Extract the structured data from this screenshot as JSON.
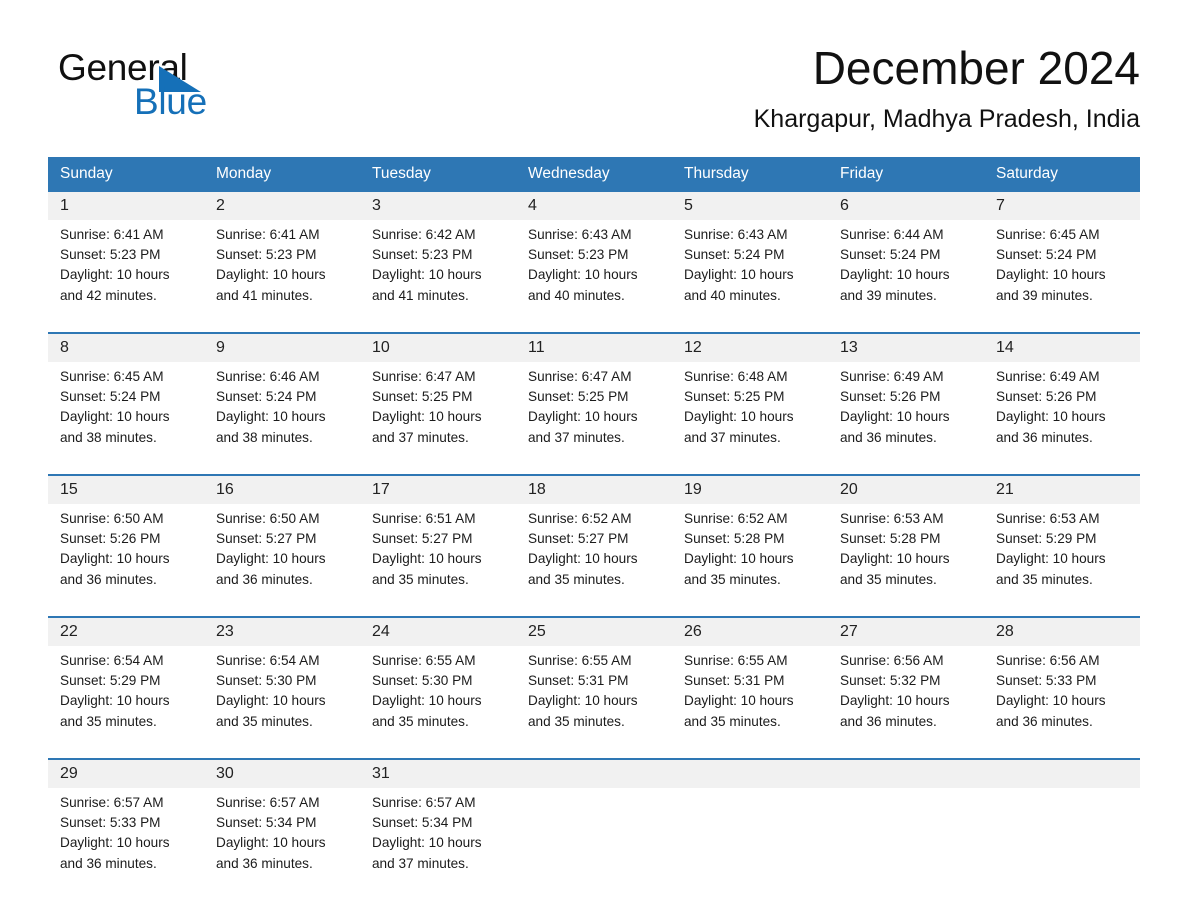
{
  "brand": {
    "name_part1": "General",
    "name_part2": "Blue",
    "triangle_icon": "triangle-icon",
    "accent_color": "#1570b8"
  },
  "header": {
    "title": "December 2024",
    "subtitle": "Khargapur, Madhya Pradesh, India"
  },
  "theme": {
    "header_blue": "#2e77b4",
    "daynum_gray": "#f1f1f1",
    "text": "#1b1b1b"
  },
  "calendar": {
    "weekday_headers": [
      "Sunday",
      "Monday",
      "Tuesday",
      "Wednesday",
      "Thursday",
      "Friday",
      "Saturday"
    ],
    "weeks": [
      [
        {
          "day": "1",
          "sunrise": "Sunrise: 6:41 AM",
          "sunset": "Sunset: 5:23 PM",
          "daylight_line1": "Daylight: 10 hours",
          "daylight_line2": "and 42 minutes."
        },
        {
          "day": "2",
          "sunrise": "Sunrise: 6:41 AM",
          "sunset": "Sunset: 5:23 PM",
          "daylight_line1": "Daylight: 10 hours",
          "daylight_line2": "and 41 minutes."
        },
        {
          "day": "3",
          "sunrise": "Sunrise: 6:42 AM",
          "sunset": "Sunset: 5:23 PM",
          "daylight_line1": "Daylight: 10 hours",
          "daylight_line2": "and 41 minutes."
        },
        {
          "day": "4",
          "sunrise": "Sunrise: 6:43 AM",
          "sunset": "Sunset: 5:23 PM",
          "daylight_line1": "Daylight: 10 hours",
          "daylight_line2": "and 40 minutes."
        },
        {
          "day": "5",
          "sunrise": "Sunrise: 6:43 AM",
          "sunset": "Sunset: 5:24 PM",
          "daylight_line1": "Daylight: 10 hours",
          "daylight_line2": "and 40 minutes."
        },
        {
          "day": "6",
          "sunrise": "Sunrise: 6:44 AM",
          "sunset": "Sunset: 5:24 PM",
          "daylight_line1": "Daylight: 10 hours",
          "daylight_line2": "and 39 minutes."
        },
        {
          "day": "7",
          "sunrise": "Sunrise: 6:45 AM",
          "sunset": "Sunset: 5:24 PM",
          "daylight_line1": "Daylight: 10 hours",
          "daylight_line2": "and 39 minutes."
        }
      ],
      [
        {
          "day": "8",
          "sunrise": "Sunrise: 6:45 AM",
          "sunset": "Sunset: 5:24 PM",
          "daylight_line1": "Daylight: 10 hours",
          "daylight_line2": "and 38 minutes."
        },
        {
          "day": "9",
          "sunrise": "Sunrise: 6:46 AM",
          "sunset": "Sunset: 5:24 PM",
          "daylight_line1": "Daylight: 10 hours",
          "daylight_line2": "and 38 minutes."
        },
        {
          "day": "10",
          "sunrise": "Sunrise: 6:47 AM",
          "sunset": "Sunset: 5:25 PM",
          "daylight_line1": "Daylight: 10 hours",
          "daylight_line2": "and 37 minutes."
        },
        {
          "day": "11",
          "sunrise": "Sunrise: 6:47 AM",
          "sunset": "Sunset: 5:25 PM",
          "daylight_line1": "Daylight: 10 hours",
          "daylight_line2": "and 37 minutes."
        },
        {
          "day": "12",
          "sunrise": "Sunrise: 6:48 AM",
          "sunset": "Sunset: 5:25 PM",
          "daylight_line1": "Daylight: 10 hours",
          "daylight_line2": "and 37 minutes."
        },
        {
          "day": "13",
          "sunrise": "Sunrise: 6:49 AM",
          "sunset": "Sunset: 5:26 PM",
          "daylight_line1": "Daylight: 10 hours",
          "daylight_line2": "and 36 minutes."
        },
        {
          "day": "14",
          "sunrise": "Sunrise: 6:49 AM",
          "sunset": "Sunset: 5:26 PM",
          "daylight_line1": "Daylight: 10 hours",
          "daylight_line2": "and 36 minutes."
        }
      ],
      [
        {
          "day": "15",
          "sunrise": "Sunrise: 6:50 AM",
          "sunset": "Sunset: 5:26 PM",
          "daylight_line1": "Daylight: 10 hours",
          "daylight_line2": "and 36 minutes."
        },
        {
          "day": "16",
          "sunrise": "Sunrise: 6:50 AM",
          "sunset": "Sunset: 5:27 PM",
          "daylight_line1": "Daylight: 10 hours",
          "daylight_line2": "and 36 minutes."
        },
        {
          "day": "17",
          "sunrise": "Sunrise: 6:51 AM",
          "sunset": "Sunset: 5:27 PM",
          "daylight_line1": "Daylight: 10 hours",
          "daylight_line2": "and 35 minutes."
        },
        {
          "day": "18",
          "sunrise": "Sunrise: 6:52 AM",
          "sunset": "Sunset: 5:27 PM",
          "daylight_line1": "Daylight: 10 hours",
          "daylight_line2": "and 35 minutes."
        },
        {
          "day": "19",
          "sunrise": "Sunrise: 6:52 AM",
          "sunset": "Sunset: 5:28 PM",
          "daylight_line1": "Daylight: 10 hours",
          "daylight_line2": "and 35 minutes."
        },
        {
          "day": "20",
          "sunrise": "Sunrise: 6:53 AM",
          "sunset": "Sunset: 5:28 PM",
          "daylight_line1": "Daylight: 10 hours",
          "daylight_line2": "and 35 minutes."
        },
        {
          "day": "21",
          "sunrise": "Sunrise: 6:53 AM",
          "sunset": "Sunset: 5:29 PM",
          "daylight_line1": "Daylight: 10 hours",
          "daylight_line2": "and 35 minutes."
        }
      ],
      [
        {
          "day": "22",
          "sunrise": "Sunrise: 6:54 AM",
          "sunset": "Sunset: 5:29 PM",
          "daylight_line1": "Daylight: 10 hours",
          "daylight_line2": "and 35 minutes."
        },
        {
          "day": "23",
          "sunrise": "Sunrise: 6:54 AM",
          "sunset": "Sunset: 5:30 PM",
          "daylight_line1": "Daylight: 10 hours",
          "daylight_line2": "and 35 minutes."
        },
        {
          "day": "24",
          "sunrise": "Sunrise: 6:55 AM",
          "sunset": "Sunset: 5:30 PM",
          "daylight_line1": "Daylight: 10 hours",
          "daylight_line2": "and 35 minutes."
        },
        {
          "day": "25",
          "sunrise": "Sunrise: 6:55 AM",
          "sunset": "Sunset: 5:31 PM",
          "daylight_line1": "Daylight: 10 hours",
          "daylight_line2": "and 35 minutes."
        },
        {
          "day": "26",
          "sunrise": "Sunrise: 6:55 AM",
          "sunset": "Sunset: 5:31 PM",
          "daylight_line1": "Daylight: 10 hours",
          "daylight_line2": "and 35 minutes."
        },
        {
          "day": "27",
          "sunrise": "Sunrise: 6:56 AM",
          "sunset": "Sunset: 5:32 PM",
          "daylight_line1": "Daylight: 10 hours",
          "daylight_line2": "and 36 minutes."
        },
        {
          "day": "28",
          "sunrise": "Sunrise: 6:56 AM",
          "sunset": "Sunset: 5:33 PM",
          "daylight_line1": "Daylight: 10 hours",
          "daylight_line2": "and 36 minutes."
        }
      ],
      [
        {
          "day": "29",
          "sunrise": "Sunrise: 6:57 AM",
          "sunset": "Sunset: 5:33 PM",
          "daylight_line1": "Daylight: 10 hours",
          "daylight_line2": "and 36 minutes."
        },
        {
          "day": "30",
          "sunrise": "Sunrise: 6:57 AM",
          "sunset": "Sunset: 5:34 PM",
          "daylight_line1": "Daylight: 10 hours",
          "daylight_line2": "and 36 minutes."
        },
        {
          "day": "31",
          "sunrise": "Sunrise: 6:57 AM",
          "sunset": "Sunset: 5:34 PM",
          "daylight_line1": "Daylight: 10 hours",
          "daylight_line2": "and 37 minutes."
        },
        {
          "day": "",
          "sunrise": "",
          "sunset": "",
          "daylight_line1": "",
          "daylight_line2": ""
        },
        {
          "day": "",
          "sunrise": "",
          "sunset": "",
          "daylight_line1": "",
          "daylight_line2": ""
        },
        {
          "day": "",
          "sunrise": "",
          "sunset": "",
          "daylight_line1": "",
          "daylight_line2": ""
        },
        {
          "day": "",
          "sunrise": "",
          "sunset": "",
          "daylight_line1": "",
          "daylight_line2": ""
        }
      ]
    ]
  }
}
